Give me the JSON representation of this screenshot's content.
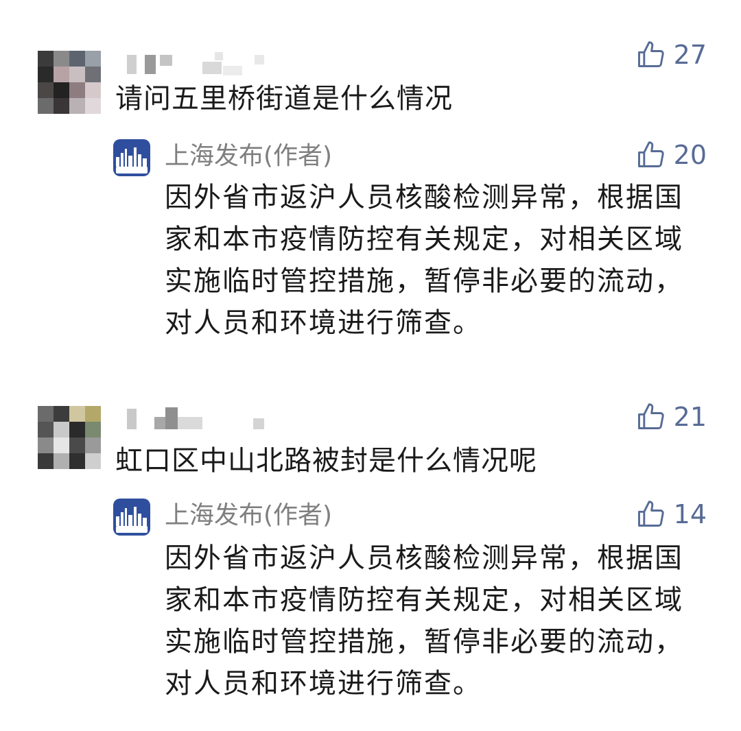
{
  "comments": [
    {
      "question": "请问五里桥街道是什么情况",
      "likes": "27",
      "reply": {
        "author": "上海发布(作者)",
        "likes": "20",
        "text": "因外省市返沪人员核酸检测异常，根据国家和本市疫情防控有关规定，对相关区域实施临时管控措施，暂停非必要的流动，对人员和环境进行筛查。"
      }
    },
    {
      "question": "虹口区中山北路被封是什么情况呢",
      "likes": "21",
      "reply": {
        "author": "上海发布(作者)",
        "likes": "14",
        "text": "因外省市返沪人员核酸检测异常，根据国家和本市疫情防控有关规定，对相关区域实施临时管控措施，暂停非必要的流动，对人员和环境进行筛查。"
      }
    }
  ],
  "colors": {
    "like_blue": "#576b95",
    "author_gray": "#7f7f7f",
    "brand_blue": "#2f4f9e"
  },
  "icons": {
    "like": "thumbs-up-icon",
    "avatar": "pixelated-avatar-icon",
    "nickname": "blurred-nickname",
    "brand_avatar": "shanghai-release-logo-icon"
  }
}
